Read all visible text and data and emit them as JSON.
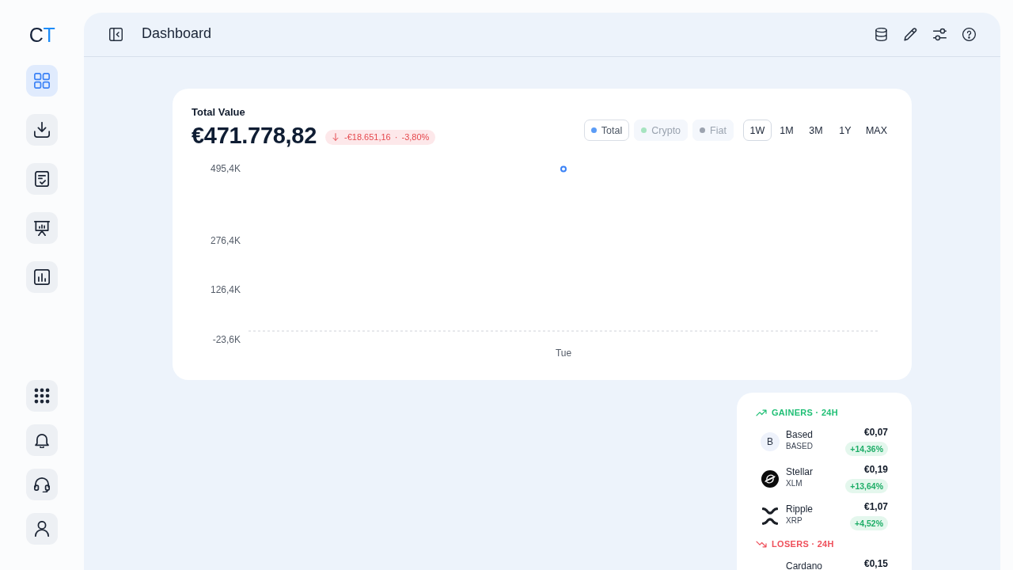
{
  "sidebar": {
    "logo": "CT",
    "nav_items": [
      {
        "selected": true
      },
      {
        "selected": false
      },
      {
        "selected": false
      },
      {
        "selected": false
      },
      {
        "selected": false
      }
    ]
  },
  "header": {
    "title": "Dashboard"
  },
  "value_card": {
    "label": "Total Value",
    "value": "€471.778,82",
    "change": {
      "down": true,
      "text": "-€18.651,16 · -3,80%"
    },
    "legend": [
      {
        "label": "Total",
        "color": "#5b9cf6",
        "selected": true
      },
      {
        "label": "Crypto",
        "color": "#a6e4c0",
        "selected": false
      },
      {
        "label": "Fiat",
        "color": "#9ca3af",
        "selected": false
      }
    ],
    "ranges": [
      {
        "label": "1W",
        "selected": true
      },
      {
        "label": "1M",
        "selected": false
      },
      {
        "label": "3M",
        "selected": false
      },
      {
        "label": "1Y",
        "selected": false
      },
      {
        "label": "MAX",
        "selected": false
      }
    ],
    "chart_data": {
      "type": "line",
      "categories": [
        "Tue"
      ],
      "series": [
        {
          "color": "#3b82f6",
          "marker": "circle",
          "values": [
            492000
          ]
        }
      ],
      "ylim": [
        -23600,
        495400
      ],
      "yticks": [
        {
          "value": 495400,
          "label": "495,4K"
        },
        {
          "value": 276400,
          "label": "276,4K"
        },
        {
          "value": 126400,
          "label": "126,4K"
        },
        {
          "value": -23600,
          "label": "-23,6K"
        }
      ],
      "ref_lines": [
        {
          "axis": "y",
          "value": 0
        }
      ]
    }
  },
  "movers": {
    "sections": [
      {
        "rising": true,
        "title": "GAINERS · 24H",
        "items": [
          {
            "avatar": "B",
            "name": "Based",
            "ticker": "BASED",
            "price": "€0,07",
            "change": "+14,36%"
          },
          {
            "name": "Stellar",
            "ticker": "XLM",
            "price": "€0,19",
            "change": "+13,64%"
          },
          {
            "name": "Ripple",
            "ticker": "XRP",
            "price": "€1,07",
            "change": "+4,52%"
          }
        ]
      },
      {
        "rising": false,
        "title": "LOSERS · 24H",
        "items": [
          {
            "name": "Cardano",
            "price": "€0,15"
          }
        ]
      }
    ]
  }
}
